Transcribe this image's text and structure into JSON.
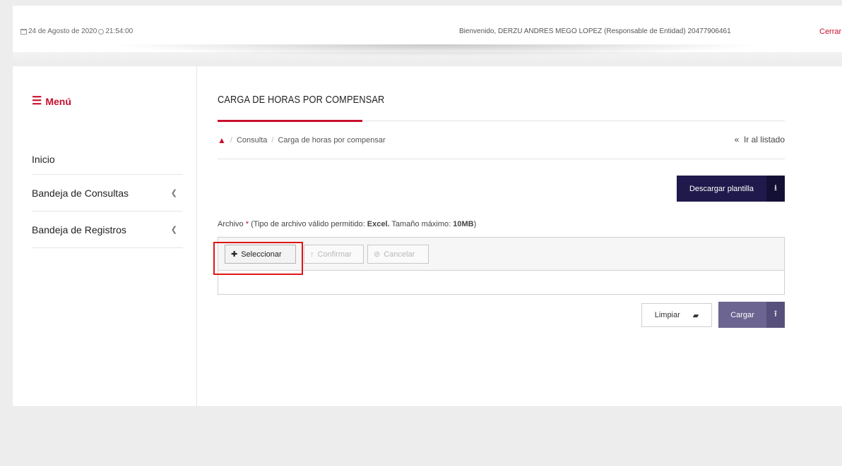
{
  "header": {
    "date": "24 de Agosto de 2020",
    "time": "21:54:00",
    "welcome": "Bienvenido, DERZU ANDRES MEGO LOPEZ (Responsable de Entidad) 20477906461",
    "logout_label": "Cerrar"
  },
  "sidebar": {
    "menu_label": "Menú",
    "items": [
      {
        "label": "Inicio",
        "has_submenu": false
      },
      {
        "label": "Bandeja de Consultas",
        "has_submenu": true
      },
      {
        "label": "Bandeja de Registros",
        "has_submenu": true
      }
    ]
  },
  "main": {
    "title": "CARGA DE HORAS POR COMPENSAR",
    "breadcrumb": [
      "Consulta",
      "Carga de horas por compensar"
    ],
    "back_link": "Ir al listado",
    "download_template_label": "Descargar plantilla",
    "file_field": {
      "label": "Archivo",
      "required_mark": "*",
      "hint_prefix": "(Tipo de archivo válido permitido: ",
      "hint_type": "Excel.",
      "hint_middle": " Tamaño máximo: ",
      "hint_size": "10MB",
      "hint_suffix": ")"
    },
    "uploader": {
      "select_label": "Seleccionar",
      "confirm_label": "Confirmar",
      "cancel_label": "Cancelar"
    },
    "clear_label": "Limpiar",
    "submit_label": "Cargar"
  },
  "colors": {
    "accent": "#c8102e",
    "primary_dark": "#1f1a4b",
    "submit": "#6c6491",
    "highlight": "#e01515"
  }
}
